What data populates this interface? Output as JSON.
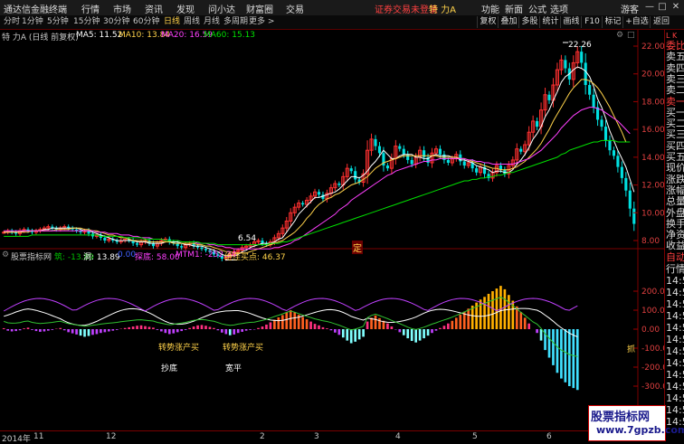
{
  "app": {
    "title": "通达信金融终端",
    "menu": [
      "行情",
      "市场",
      "资讯",
      "发现",
      "问小达",
      "财富圈",
      "交易"
    ],
    "alert": "证券交易未登录",
    "stock_title": "特 力A",
    "right_menu": [
      "功能",
      "新面",
      "公式",
      "选项"
    ],
    "user": "游客",
    "window_buttons": [
      "minimize-icon",
      "maximize-icon",
      "close-icon"
    ]
  },
  "toolbar": {
    "periods": [
      "分时",
      "1分钟",
      "5分钟",
      "15分钟",
      "30分钟",
      "60分钟",
      "日线",
      "周线",
      "月线",
      "多周期",
      "更多 >"
    ],
    "active_period": "日线",
    "buttons": [
      "复权",
      "叠加",
      "多股",
      "统计",
      "画线",
      "F10",
      "标记",
      "+自选",
      "返回"
    ]
  },
  "chart_header": {
    "name": "特 力A (日线 前复权)",
    "ma5": "MA5: 11.52",
    "ma10": "MA10: 13.84",
    "ma20": "MA20: 16.59",
    "ma60": "MA60: 15.13",
    "colors": {
      "ma5": "#ffffff",
      "ma10": "#ffd24a",
      "ma20": "#ff40ff",
      "ma60": "#00e000"
    }
  },
  "price_axis": [
    "22.00",
    "20.00",
    "18.00",
    "16.00",
    "14.00",
    "12.00",
    "10.00",
    "8.00"
  ],
  "price_annotations": {
    "high": "22.26",
    "low": "6.54",
    "marker": "定"
  },
  "indicator_header": {
    "name": "股票指标网",
    "a": "筑: -13.89",
    "b": "洞: 13.89",
    "c": "0.00",
    "d": "探底: 58.00",
    "e": "MTM1: -252.34",
    "f": "绝佳买点: 46.37"
  },
  "indicator_axis": [
    "200.0",
    "100.0",
    "0.00",
    "-100.0",
    "-200.0",
    "-300.0"
  ],
  "indicator_labels": [
    "转势涨产买",
    "转势涨产买",
    "抄底",
    "宽平",
    "抓"
  ],
  "right_panel": {
    "header": "L K",
    "items": [
      "委比",
      "卖五",
      "卖四",
      "卖三",
      "卖二",
      "卖一",
      "买一",
      "买二",
      "买三",
      "买四",
      "买五",
      "现价",
      "涨跌",
      "涨幅",
      "总量",
      "外盘",
      "换手",
      "净资",
      "收益"
    ],
    "lower_header": "自动",
    "lower_items": [
      "行情",
      "14:5",
      "14:5",
      "14:5",
      "14:5",
      "14:5",
      "14:5",
      "14:5",
      "14:5",
      "14:5",
      "14:5",
      "14:5",
      "14:5",
      "14:5"
    ]
  },
  "date_axis": [
    "2014年",
    "11",
    "12",
    "2",
    "3",
    "4",
    "5",
    "6"
  ],
  "watermark": {
    "line1": "股票指标网",
    "line2": "www.7gpzb.com"
  },
  "chart_data": {
    "type": "candlestick",
    "price_range": [
      6.0,
      23.0
    ],
    "indicator_range": [
      -330,
      270
    ],
    "close": [
      8.6,
      8.7,
      8.6,
      8.5,
      8.7,
      8.8,
      8.7,
      8.6,
      8.7,
      8.8,
      8.9,
      9.0,
      8.9,
      8.8,
      8.9,
      9.0,
      8.9,
      8.8,
      8.7,
      8.6,
      8.7,
      8.5,
      8.3,
      8.4,
      8.2,
      8.0,
      8.1,
      8.0,
      7.9,
      8.0,
      8.1,
      8.0,
      7.8,
      7.7,
      7.9,
      8.0,
      7.8,
      7.6,
      7.8,
      8.0,
      8.1,
      7.9,
      7.8,
      7.6,
      7.5,
      7.7,
      7.8,
      7.6,
      7.5,
      7.4,
      7.3,
      7.2,
      7.0,
      6.9,
      6.7,
      6.8,
      7.0,
      7.2,
      7.3,
      7.5,
      7.6,
      7.7,
      7.9,
      8.0,
      7.8,
      7.7,
      7.9,
      8.2,
      8.5,
      8.9,
      9.4,
      10.0,
      10.4,
      10.7,
      10.6,
      10.9,
      11.2,
      11.5,
      11.3,
      11.0,
      11.4,
      11.8,
      12.1,
      12.0,
      12.6,
      13.2,
      13.0,
      12.4,
      12.2,
      12.8,
      14.5,
      15.3,
      14.8,
      14.3,
      13.4,
      13.2,
      13.9,
      14.8,
      14.6,
      14.2,
      13.8,
      13.5,
      14.0,
      14.5,
      14.0,
      13.6,
      14.3,
      14.6,
      14.2,
      13.8,
      13.6,
      13.9,
      14.2,
      13.7,
      13.4,
      13.6,
      13.2,
      12.9,
      13.3,
      12.8,
      12.5,
      12.9,
      13.4,
      13.1,
      12.8,
      13.4,
      13.8,
      14.6,
      14.4,
      14.9,
      15.8,
      16.6,
      16.2,
      17.4,
      18.5,
      18.1,
      19.2,
      20.3,
      21.0,
      20.4,
      19.6,
      20.8,
      21.6,
      20.8,
      19.2,
      18.5,
      17.6,
      16.7,
      16.2,
      15.2,
      14.5,
      14.1,
      13.3,
      12.5,
      11.6,
      10.3,
      9.2
    ],
    "ma5": [
      8.6,
      8.6,
      8.6,
      8.6,
      8.6,
      8.7,
      8.7,
      8.7,
      8.7,
      8.7,
      8.8,
      8.8,
      8.9,
      8.9,
      8.9,
      8.9,
      8.9,
      8.9,
      8.9,
      8.8,
      8.7,
      8.7,
      8.6,
      8.5,
      8.4,
      8.3,
      8.2,
      8.1,
      8.0,
      8.0,
      8.0,
      8.0,
      8.0,
      7.9,
      7.9,
      7.9,
      7.8,
      7.8,
      7.8,
      7.8,
      7.9,
      7.9,
      7.9,
      7.9,
      7.8,
      7.7,
      7.7,
      7.6,
      7.6,
      7.6,
      7.5,
      7.4,
      7.3,
      7.2,
      7.0,
      6.9,
      6.9,
      6.9,
      7.0,
      7.2,
      7.3,
      7.5,
      7.6,
      7.7,
      7.8,
      7.8,
      7.8,
      7.9,
      8.1,
      8.2,
      8.6,
      9.0,
      9.4,
      9.9,
      10.2,
      10.5,
      10.8,
      11.1,
      11.1,
      11.2,
      11.3,
      11.4,
      11.5,
      11.7,
      12.0,
      12.3,
      12.6,
      12.6,
      12.5,
      12.7,
      13.0,
      13.4,
      13.7,
      14.1,
      14.5,
      14.2,
      13.9,
      13.9,
      14.1,
      14.2,
      14.2,
      14.2,
      14.0,
      14.0,
      13.9,
      13.9,
      14.1,
      14.2,
      14.1,
      14.1,
      14.1,
      14.0,
      14.0,
      13.8,
      13.8,
      13.7,
      13.6,
      13.4,
      13.3,
      13.2,
      13.1,
      12.9,
      13.0,
      13.0,
      12.9,
      12.9,
      13.1,
      13.5,
      13.8,
      14.2,
      14.7,
      15.3,
      15.7,
      16.2,
      16.9,
      17.4,
      18.1,
      18.7,
      19.4,
      19.8,
      20.0,
      20.3,
      20.5,
      20.4,
      20.2,
      19.8,
      19.1,
      18.2,
      17.6,
      16.8,
      15.9,
      15.2,
      14.5,
      13.9,
      13.3,
      12.4,
      11.5
    ],
    "ma10": [
      8.6,
      8.6,
      8.6,
      8.6,
      8.6,
      8.6,
      8.6,
      8.7,
      8.7,
      8.7,
      8.7,
      8.7,
      8.7,
      8.8,
      8.8,
      8.8,
      8.8,
      8.9,
      8.9,
      8.9,
      8.8,
      8.8,
      8.7,
      8.7,
      8.6,
      8.5,
      8.4,
      8.4,
      8.3,
      8.2,
      8.2,
      8.1,
      8.0,
      8.0,
      8.0,
      8.0,
      7.9,
      7.9,
      7.9,
      7.9,
      7.9,
      7.9,
      7.8,
      7.8,
      7.8,
      7.8,
      7.8,
      7.8,
      7.7,
      7.7,
      7.6,
      7.6,
      7.5,
      7.4,
      7.3,
      7.2,
      7.2,
      7.1,
      7.1,
      7.1,
      7.1,
      7.2,
      7.3,
      7.4,
      7.5,
      7.6,
      7.7,
      7.8,
      7.9,
      8.0,
      8.2,
      8.4,
      8.6,
      8.9,
      9.2,
      9.6,
      9.9,
      10.3,
      10.6,
      10.8,
      11.0,
      11.1,
      11.3,
      11.4,
      11.6,
      11.8,
      12.0,
      12.1,
      12.2,
      12.4,
      12.6,
      12.9,
      13.2,
      13.4,
      13.6,
      13.7,
      13.8,
      13.9,
      14.0,
      14.1,
      14.1,
      14.1,
      14.1,
      14.1,
      14.1,
      14.1,
      14.1,
      14.1,
      14.0,
      14.0,
      14.0,
      14.0,
      14.0,
      13.9,
      13.9,
      13.8,
      13.7,
      13.6,
      13.5,
      13.4,
      13.3,
      13.2,
      13.2,
      13.1,
      13.1,
      13.1,
      13.2,
      13.3,
      13.5,
      13.7,
      14.0,
      14.3,
      14.6,
      15.0,
      15.5,
      16.0,
      16.6,
      17.1,
      17.6,
      18.1,
      18.6,
      19.0,
      19.3,
      19.6,
      19.6,
      19.5,
      19.3,
      19.0,
      18.6,
      18.1,
      17.6,
      17.0,
      16.4,
      15.8,
      15.1
    ],
    "ma20": [
      8.7,
      8.7,
      8.7,
      8.7,
      8.7,
      8.7,
      8.7,
      8.7,
      8.7,
      8.7,
      8.7,
      8.7,
      8.7,
      8.7,
      8.7,
      8.7,
      8.7,
      8.7,
      8.7,
      8.7,
      8.7,
      8.7,
      8.7,
      8.6,
      8.6,
      8.6,
      8.5,
      8.5,
      8.5,
      8.4,
      8.4,
      8.4,
      8.3,
      8.3,
      8.2,
      8.2,
      8.2,
      8.1,
      8.1,
      8.1,
      8.0,
      8.0,
      8.0,
      8.0,
      7.9,
      7.9,
      7.9,
      7.9,
      7.8,
      7.8,
      7.8,
      7.7,
      7.7,
      7.6,
      7.6,
      7.5,
      7.5,
      7.4,
      7.4,
      7.4,
      7.4,
      7.4,
      7.4,
      7.4,
      7.4,
      7.4,
      7.4,
      7.5,
      7.5,
      7.6,
      7.7,
      7.8,
      8.0,
      8.1,
      8.3,
      8.5,
      8.7,
      8.9,
      9.1,
      9.3,
      9.5,
      9.7,
      9.9,
      10.2,
      10.4,
      10.6,
      10.9,
      11.1,
      11.3,
      11.5,
      11.7,
      11.9,
      12.1,
      12.3,
      12.5,
      12.7,
      12.8,
      13.0,
      13.1,
      13.2,
      13.3,
      13.4,
      13.5,
      13.6,
      13.7,
      13.7,
      13.8,
      13.8,
      13.9,
      13.9,
      13.9,
      13.9,
      13.9,
      13.9,
      13.9,
      13.8,
      13.8,
      13.7,
      13.7,
      13.6,
      13.6,
      13.5,
      13.5,
      13.5,
      13.5,
      13.5,
      13.5,
      13.6,
      13.7,
      13.8,
      13.9,
      14.1,
      14.3,
      14.5,
      14.8,
      15.1,
      15.4,
      15.7,
      16.1,
      16.4,
      16.7,
      17.0,
      17.2,
      17.4,
      17.5,
      17.6,
      17.6,
      17.5,
      17.4,
      17.2,
      17.0,
      16.8,
      16.6,
      16.3,
      16.0,
      15.7
    ],
    "ma60": [
      8.3,
      8.3,
      8.3,
      8.3,
      8.3,
      8.3,
      8.3,
      8.4,
      8.4,
      8.4,
      8.4,
      8.4,
      8.4,
      8.4,
      8.4,
      8.4,
      8.4,
      8.4,
      8.4,
      8.4,
      8.4,
      8.4,
      8.4,
      8.4,
      8.3,
      8.3,
      8.3,
      8.3,
      8.3,
      8.3,
      8.2,
      8.2,
      8.2,
      8.2,
      8.2,
      8.1,
      8.1,
      8.1,
      8.1,
      8.1,
      8.0,
      8.0,
      8.0,
      8.0,
      7.9,
      7.9,
      7.9,
      7.9,
      7.9,
      7.8,
      7.8,
      7.8,
      7.8,
      7.7,
      7.7,
      7.7,
      7.7,
      7.7,
      7.7,
      7.7,
      7.7,
      7.7,
      7.7,
      7.7,
      7.7,
      7.7,
      7.8,
      7.8,
      7.8,
      7.9,
      7.9,
      8.0,
      8.1,
      8.2,
      8.3,
      8.4,
      8.5,
      8.6,
      8.7,
      8.8,
      8.9,
      9.0,
      9.1,
      9.2,
      9.3,
      9.4,
      9.5,
      9.6,
      9.7,
      9.8,
      9.9,
      10.0,
      10.1,
      10.2,
      10.3,
      10.4,
      10.5,
      10.6,
      10.7,
      10.8,
      10.9,
      11.0,
      11.1,
      11.2,
      11.3,
      11.4,
      11.5,
      11.6,
      11.7,
      11.8,
      11.9,
      12.0,
      12.1,
      12.2,
      12.3,
      12.3,
      12.4,
      12.4,
      12.5,
      12.5,
      12.6,
      12.6,
      12.7,
      12.7,
      12.8,
      12.9,
      12.9,
      13.0,
      13.1,
      13.2,
      13.3,
      13.4,
      13.5,
      13.6,
      13.7,
      13.8,
      13.9,
      14.0,
      14.2,
      14.3,
      14.5,
      14.6,
      14.7,
      14.8,
      14.9,
      15.0,
      15.1,
      15.1,
      15.2,
      15.2,
      15.2,
      15.2,
      15.1,
      15.1,
      15.1,
      15.1
    ],
    "indicator": [
      5,
      -8,
      -12,
      -10,
      -6,
      4,
      8,
      -4,
      -10,
      -14,
      -12,
      -8,
      -4,
      2,
      6,
      -6,
      -16,
      -22,
      -28,
      -34,
      -40,
      -36,
      -30,
      -26,
      -20,
      -16,
      -12,
      -8,
      -4,
      2,
      6,
      10,
      14,
      18,
      20,
      16,
      12,
      8,
      -4,
      -12,
      -20,
      -26,
      -22,
      -16,
      -10,
      -4,
      6,
      14,
      20,
      22,
      18,
      12,
      6,
      -6,
      -18,
      -26,
      -32,
      -28,
      -20,
      -14,
      -8,
      -4,
      -2,
      6,
      14,
      24,
      36,
      50,
      62,
      74,
      88,
      100,
      90,
      76,
      64,
      52,
      40,
      28,
      20,
      10,
      4,
      -6,
      -18,
      -30,
      -44,
      -60,
      -74,
      -66,
      -54,
      -40,
      40,
      60,
      72,
      58,
      44,
      30,
      14,
      -2,
      -16,
      -32,
      -48,
      -62,
      -70,
      -60,
      -48,
      -34,
      -20,
      -8,
      6,
      18,
      30,
      44,
      60,
      76,
      92,
      108,
      124,
      140,
      156,
      170,
      186,
      200,
      214,
      228,
      210,
      180,
      150,
      120,
      90,
      60,
      30,
      0,
      -20,
      -60,
      -110,
      -150,
      -190,
      -230,
      -260,
      -280,
      -300,
      -310,
      -320
    ]
  }
}
